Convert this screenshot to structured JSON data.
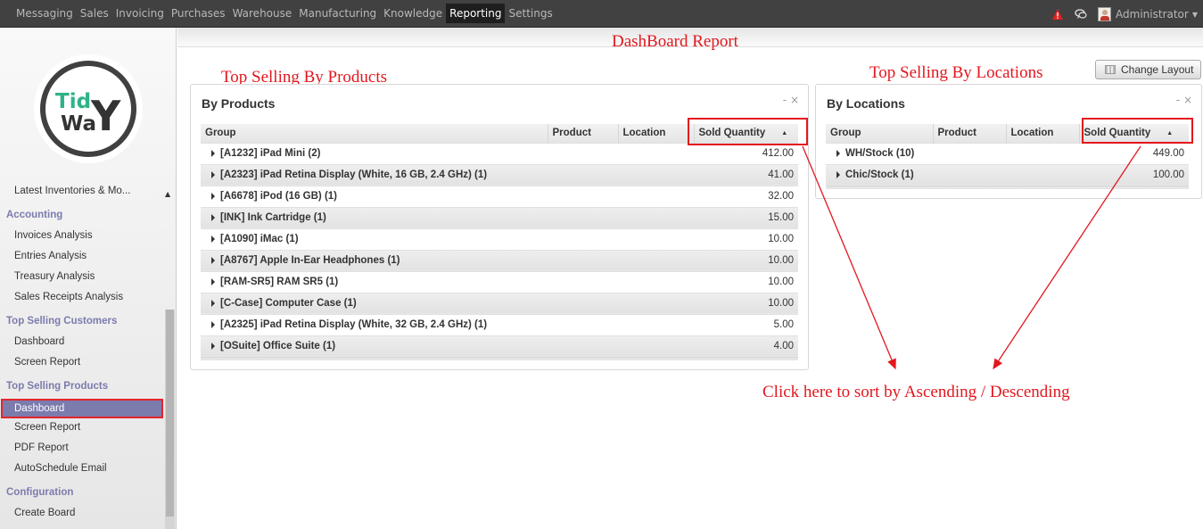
{
  "topbar": {
    "menu": [
      "Messaging",
      "Sales",
      "Invoicing",
      "Purchases",
      "Warehouse",
      "Manufacturing",
      "Knowledge",
      "Reporting",
      "Settings"
    ],
    "active": "Reporting",
    "user": "Administrator"
  },
  "sidebar": {
    "logo_text": [
      "Tid",
      "Wa",
      "Y"
    ],
    "latest": "Latest Inventories & Mo...",
    "sections": [
      {
        "title": "Accounting",
        "items": [
          "Invoices Analysis",
          "Entries Analysis",
          "Treasury Analysis",
          "Sales Receipts Analysis"
        ]
      },
      {
        "title": "Top Selling Customers",
        "items": [
          "Dashboard",
          "Screen Report"
        ]
      },
      {
        "title": "Top Selling Products",
        "items": [
          "Dashboard",
          "Screen Report",
          "PDF Report",
          "AutoSchedule Email"
        ]
      },
      {
        "title": "Configuration",
        "items": [
          "Create Board"
        ]
      }
    ]
  },
  "annotations": {
    "header": "DashBoard Report",
    "products": "Top Selling By Products",
    "locations": "Top Selling By Locations",
    "sort_hint": "Click here to sort by Ascending / Descending"
  },
  "change_layout": "Change Layout",
  "by_products": {
    "title": "By Products",
    "controls": "- ×",
    "columns": [
      "Group",
      "Product",
      "Location",
      "Sold Quantity"
    ],
    "rows": [
      {
        "group": "[A1232] iPad Mini (2)",
        "qty": "412.00"
      },
      {
        "group": "[A2323] iPad Retina Display (White, 16 GB, 2.4 GHz) (1)",
        "qty": "41.00"
      },
      {
        "group": "[A6678] iPod (16 GB) (1)",
        "qty": "32.00"
      },
      {
        "group": "[INK] Ink Cartridge (1)",
        "qty": "15.00"
      },
      {
        "group": "[A1090] iMac (1)",
        "qty": "10.00"
      },
      {
        "group": "[A8767] Apple In-Ear Headphones (1)",
        "qty": "10.00"
      },
      {
        "group": "[RAM-SR5] RAM SR5 (1)",
        "qty": "10.00"
      },
      {
        "group": "[C-Case] Computer Case (1)",
        "qty": "10.00"
      },
      {
        "group": "[A2325] iPad Retina Display (White, 32 GB, 2.4 GHz) (1)",
        "qty": "5.00"
      },
      {
        "group": "[OSuite] Office Suite (1)",
        "qty": "4.00"
      }
    ]
  },
  "by_locations": {
    "title": "By Locations",
    "controls": "- ×",
    "columns": [
      "Group",
      "Product",
      "Location",
      "Sold Quantity"
    ],
    "rows": [
      {
        "group": "WH/Stock (10)",
        "qty": "449.00"
      },
      {
        "group": "Chic/Stock (1)",
        "qty": "100.00"
      }
    ]
  },
  "colors": {
    "accent": "#7c7bad",
    "annotation": "#e3171e",
    "topbar": "#414141"
  }
}
